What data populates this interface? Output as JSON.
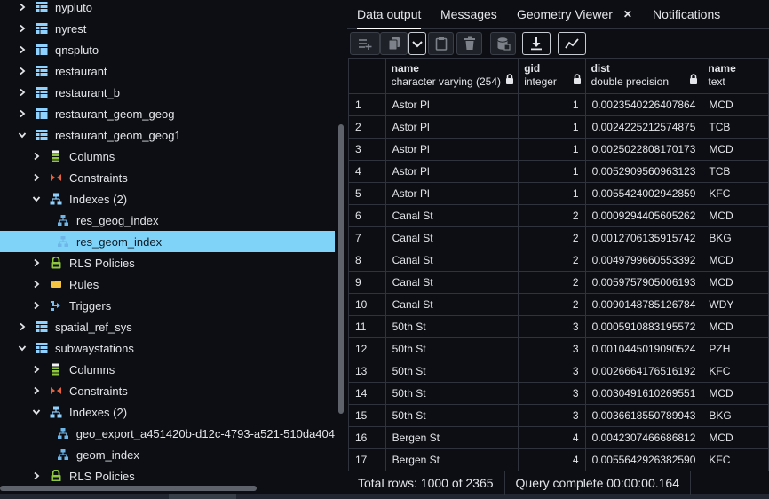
{
  "tree": {
    "items": [
      {
        "label": "nypluto",
        "icon": "table-icon",
        "chevron": "right",
        "indent": 0
      },
      {
        "label": "nyrest",
        "icon": "table-icon",
        "chevron": "right",
        "indent": 0
      },
      {
        "label": "qnspluto",
        "icon": "table-icon",
        "chevron": "right",
        "indent": 0
      },
      {
        "label": "restaurant",
        "icon": "table-icon",
        "chevron": "right",
        "indent": 0
      },
      {
        "label": "restaurant_b",
        "icon": "table-icon",
        "chevron": "right",
        "indent": 0
      },
      {
        "label": "restaurant_geom_geog",
        "icon": "table-icon",
        "chevron": "right",
        "indent": 0
      },
      {
        "label": "restaurant_geom_geog1",
        "icon": "table-icon",
        "chevron": "down",
        "indent": 0
      },
      {
        "label": "Columns",
        "icon": "columns-icon",
        "chevron": "right",
        "indent": 1
      },
      {
        "label": "Constraints",
        "icon": "constraints-icon",
        "chevron": "right",
        "indent": 1
      },
      {
        "label": "Indexes (2)",
        "icon": "indexes-icon",
        "chevron": "down",
        "indent": 1
      },
      {
        "label": "res_geog_index",
        "icon": "index-icon",
        "chevron": "none",
        "indent": 2
      },
      {
        "label": "res_geom_index",
        "icon": "index-icon",
        "chevron": "none",
        "indent": 2,
        "selected": true
      },
      {
        "label": "RLS Policies",
        "icon": "rls-policies-icon",
        "chevron": "right",
        "indent": 1
      },
      {
        "label": "Rules",
        "icon": "rules-icon",
        "chevron": "right",
        "indent": 1
      },
      {
        "label": "Triggers",
        "icon": "triggers-icon",
        "chevron": "right",
        "indent": 1
      },
      {
        "label": "spatial_ref_sys",
        "icon": "table-icon",
        "chevron": "right",
        "indent": 0
      },
      {
        "label": "subwaystations",
        "icon": "table-icon",
        "chevron": "down",
        "indent": 0
      },
      {
        "label": "Columns",
        "icon": "columns-icon",
        "chevron": "right",
        "indent": 1
      },
      {
        "label": "Constraints",
        "icon": "constraints-icon",
        "chevron": "right",
        "indent": 1
      },
      {
        "label": "Indexes (2)",
        "icon": "indexes-icon",
        "chevron": "down",
        "indent": 1
      },
      {
        "label": "geo_export_a451420b-d12c-4793-a521-510da404",
        "icon": "index-icon",
        "chevron": "none",
        "indent": 2
      },
      {
        "label": "geom_index",
        "icon": "index-icon",
        "chevron": "none",
        "indent": 2
      },
      {
        "label": "RLS Policies",
        "icon": "rls-policies-icon",
        "chevron": "right",
        "indent": 1
      }
    ]
  },
  "tabs": [
    {
      "label": "Data output",
      "active": true
    },
    {
      "label": "Messages",
      "active": false
    },
    {
      "label": "Geometry Viewer",
      "active": false,
      "closable": true
    },
    {
      "label": "Notifications",
      "active": false
    }
  ],
  "close_glyph": "✕",
  "toolbar": [
    {
      "name": "add-row-button",
      "icon": "add-row-icon"
    },
    {
      "name": "copy-button",
      "icon": "copy-icon"
    },
    {
      "name": "copy-options-dropdown",
      "icon": "chevron-down-icon"
    },
    {
      "name": "paste-button",
      "icon": "paste-icon"
    },
    {
      "name": "delete-button",
      "icon": "delete-icon"
    },
    {
      "name": "save-data-button",
      "icon": "save-data-icon"
    },
    {
      "name": "download-button",
      "icon": "download-icon"
    },
    {
      "name": "graph-visualiser-button",
      "icon": "graph-icon"
    }
  ],
  "grid": {
    "columns": [
      {
        "name": "name",
        "type": "character varying (254)",
        "locked": true
      },
      {
        "name": "gid",
        "type": "integer",
        "locked": true
      },
      {
        "name": "dist",
        "type": "double precision",
        "locked": true
      },
      {
        "name": "name",
        "type": "text",
        "locked": true
      }
    ],
    "rows": [
      [
        "1",
        "Astor Pl",
        "1",
        "0.0023540226407864",
        "MCD"
      ],
      [
        "2",
        "Astor Pl",
        "1",
        "0.0024225212574875",
        "TCB"
      ],
      [
        "3",
        "Astor Pl",
        "1",
        "0.0025022808170173",
        "MCD"
      ],
      [
        "4",
        "Astor Pl",
        "1",
        "0.0052909560963123",
        "TCB"
      ],
      [
        "5",
        "Astor Pl",
        "1",
        "0.0055424002942859",
        "KFC"
      ],
      [
        "6",
        "Canal St",
        "2",
        "0.0009294405605262",
        "MCD"
      ],
      [
        "7",
        "Canal St",
        "2",
        "0.0012706135915742",
        "BKG"
      ],
      [
        "8",
        "Canal St",
        "2",
        "0.0049799660553392",
        "MCD"
      ],
      [
        "9",
        "Canal St",
        "2",
        "0.0059757905006193",
        "MCD"
      ],
      [
        "10",
        "Canal St",
        "2",
        "0.0090148785126784",
        "WDY"
      ],
      [
        "11",
        "50th St",
        "3",
        "0.0005910883195572",
        "MCD"
      ],
      [
        "12",
        "50th St",
        "3",
        "0.0010445019090524",
        "PZH"
      ],
      [
        "13",
        "50th St",
        "3",
        "0.0026664176516192",
        "KFC"
      ],
      [
        "14",
        "50th St",
        "3",
        "0.0030491610269551",
        "MCD"
      ],
      [
        "15",
        "50th St",
        "3",
        "0.0036618550789943",
        "BKG"
      ],
      [
        "16",
        "Bergen St",
        "4",
        "0.0042307466686812",
        "MCD"
      ],
      [
        "17",
        "Bergen St",
        "4",
        "0.0055642926382590",
        "KFC"
      ]
    ]
  },
  "status": {
    "total_rows": "Total rows: 1000 of 2365",
    "query": "Query complete 00:00:00.164"
  },
  "colors": {
    "background": "#0c0e13",
    "selected_row": "#7fd3f9",
    "table_icon": "#8fd2ff",
    "constraints_icon": "#e8603c",
    "rls_icon": "#8ec63f",
    "rules_icon": "#f5c542"
  }
}
